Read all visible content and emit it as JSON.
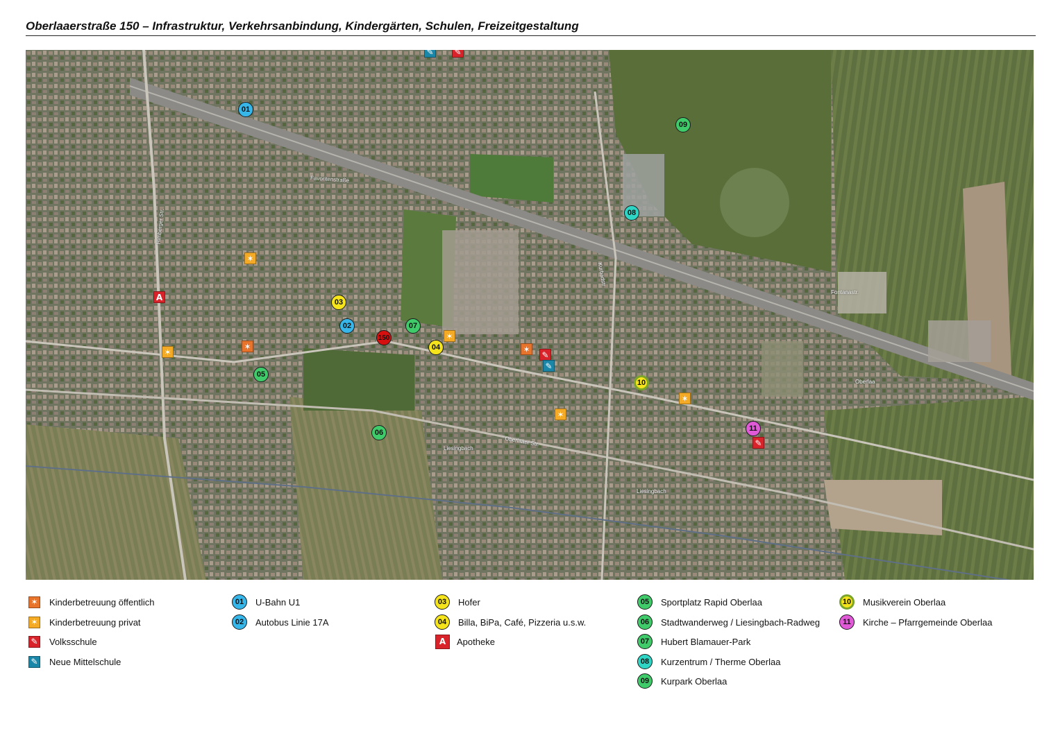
{
  "title": "Oberlaaerstraße 150 – Infrastruktur, Verkehrsanbindung, Kindergärten, Schulen, Freizeitgestaltung",
  "colors": {
    "kinder_oeffentlich": "#e8742c",
    "kinder_privat": "#f4aa25",
    "volksschule": "#d9232a",
    "nms": "#1a87a8",
    "apotheke": "#d9232a",
    "transport": "#37b6ea",
    "shopping": "#f5e31b",
    "leisure": "#3fcb6a",
    "therme": "#2ed4c4",
    "musik_ring": "#7aa52a",
    "musik_fill": "#f5e31b",
    "kirche": "#e05ad8",
    "property": "#d60f0f"
  },
  "map": {
    "property_label": "150",
    "markers": [
      {
        "id": "01",
        "category": "transport"
      },
      {
        "id": "02",
        "category": "transport"
      },
      {
        "id": "03",
        "category": "shopping"
      },
      {
        "id": "04",
        "category": "shopping"
      },
      {
        "id": "05",
        "category": "leisure"
      },
      {
        "id": "06",
        "category": "leisure"
      },
      {
        "id": "07",
        "category": "leisure"
      },
      {
        "id": "08",
        "category": "therme"
      },
      {
        "id": "09",
        "category": "leisure"
      },
      {
        "id": "10",
        "category": "musik"
      },
      {
        "id": "11",
        "category": "kirche"
      }
    ],
    "street_labels": {
      "l1": "Himberger Str.",
      "l2": "Liesingbach",
      "l3": "Kurbadstr.",
      "l4": "Oberlaaer Str.",
      "l5": "Liesingbach",
      "l6": "Fontanastr.",
      "l7": "Oberlaa",
      "l8": "Favoritenstraße"
    }
  },
  "legend": {
    "col1": [
      {
        "icon": "kinder-oeffentlich",
        "label": "Kinderbetreuung öffentlich"
      },
      {
        "icon": "kinder-privat",
        "label": "Kinderbetreuung privat"
      },
      {
        "icon": "volksschule",
        "label": "Volksschule"
      },
      {
        "icon": "nms",
        "label": "Neue Mittelschule"
      }
    ],
    "col2": [
      {
        "num": "01",
        "label": "U-Bahn U1"
      },
      {
        "num": "02",
        "label": "Autobus Linie 17A"
      }
    ],
    "col3": [
      {
        "num": "03",
        "label": "Hofer"
      },
      {
        "num": "04",
        "label": "Billa, BiPa, Café, Pizzeria u.s.w."
      },
      {
        "icon": "apotheke",
        "label": "Apotheke"
      }
    ],
    "col4": [
      {
        "num": "05",
        "label": "Sportplatz Rapid Oberlaa"
      },
      {
        "num": "06",
        "label": "Stadtwanderweg / Liesingbach-Radweg"
      },
      {
        "num": "07",
        "label": "Hubert Blamauer-Park"
      },
      {
        "num": "08",
        "label": "Kurzentrum / Therme Oberlaa"
      },
      {
        "num": "09",
        "label": "Kurpark Oberlaa"
      }
    ],
    "col5": [
      {
        "num": "10",
        "label": "Musikverein Oberlaa"
      },
      {
        "num": "11",
        "label": "Kirche – Pfarrgemeinde Oberlaa"
      }
    ]
  }
}
